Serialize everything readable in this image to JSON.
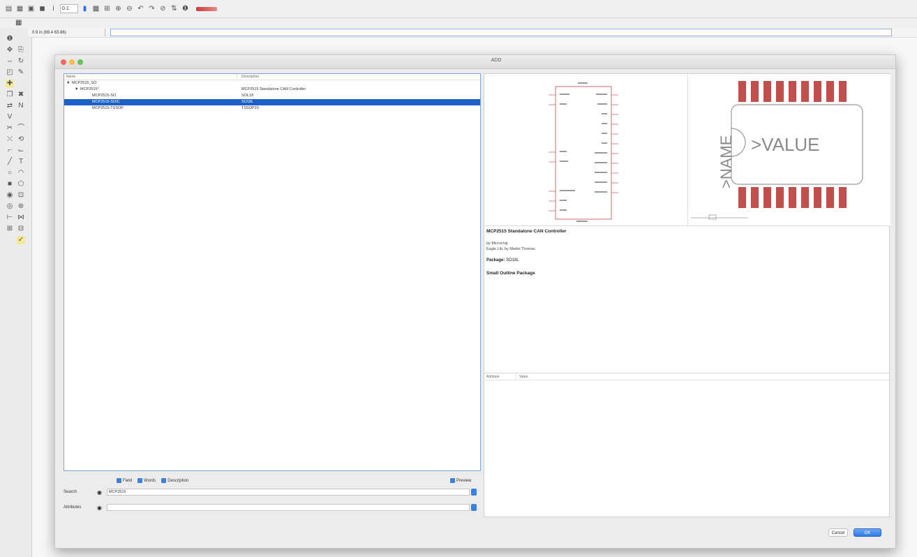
{
  "toolbar": {
    "icons": [
      "file-icon",
      "save-icon",
      "print-icon",
      "cam-icon",
      "layer-icon",
      "grid-icon",
      "select-icon",
      "zoom-fit-icon",
      "zoom-in-icon",
      "zoom-out-icon",
      "undo-icon",
      "redo-icon",
      "stop-icon",
      "go-icon",
      "info-icon",
      "script-icon"
    ],
    "grid_value": "0.1",
    "accent_color": "#2f6fd6"
  },
  "command": {
    "coord_readout": "0.9 in (69.4 63.86)",
    "value": ""
  },
  "dialog": {
    "title": "ADD",
    "tree": {
      "col_name": "Name",
      "col_desc": "Description",
      "rows": [
        {
          "name": "MCP2515_SO",
          "desc": "",
          "indent": 1,
          "toggle": "▼"
        },
        {
          "name": "MCP2515*",
          "desc": "MCP2515 Standalone CAN Controller",
          "indent": 2,
          "toggle": "▼"
        },
        {
          "name": "MCP2515-SO",
          "desc": "SOL18",
          "indent": 3,
          "toggle": ""
        },
        {
          "name": "MCP2515-SOIC",
          "desc": "SO18L",
          "indent": 3,
          "toggle": "",
          "selected": true
        },
        {
          "name": "MCP2515-TSSOP",
          "desc": "TSSOP20",
          "indent": 3,
          "toggle": ""
        }
      ]
    },
    "filters": {
      "field": "Field",
      "words": "Words",
      "description": "Description",
      "preview": "Preview"
    },
    "search_label": "Search",
    "search_value": "MCP2515",
    "attributes_label": "Attributes",
    "attributes_value": "",
    "info": {
      "title": "MCP2515 Standalone CAN Controller",
      "line1": "by Microchip",
      "line2": "Eagle Lib. by Martin Thomas",
      "package_label": "Package:",
      "package_value": "SO18L",
      "package_desc": "Small Outline Package"
    },
    "attr_col1": "Attribute",
    "attr_col2": "Value",
    "cancel_label": "Cancel",
    "ok_label": "OK",
    "pkg_name": ">NAME",
    "pkg_value": ">VALUE"
  }
}
